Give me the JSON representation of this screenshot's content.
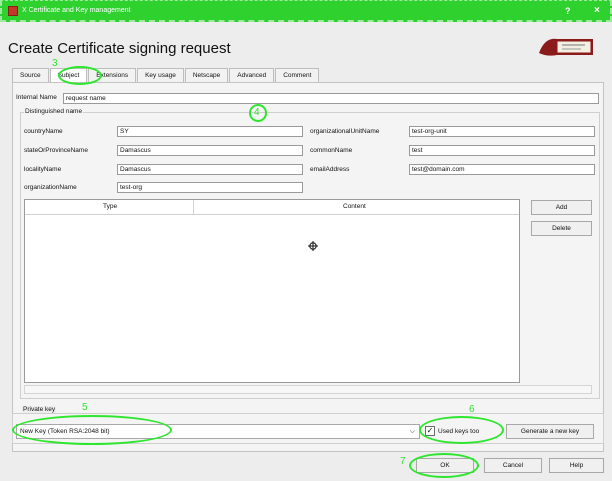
{
  "window": {
    "title": "X Certificate and Key management",
    "help": "?",
    "close": "×"
  },
  "dialog": {
    "heading": "Create Certificate signing request"
  },
  "tabs": [
    "Source",
    "Subject",
    "Extensions",
    "Key usage",
    "Netscape",
    "Advanced",
    "Comment"
  ],
  "subject": {
    "internal_name_label": "Internal Name",
    "internal_name_value": "request name",
    "group_label": "Distinguished name",
    "fields": {
      "countryName": {
        "label": "countryName",
        "value": "SY"
      },
      "stateOrProvinceName": {
        "label": "stateOrProvinceName",
        "value": "Damascus"
      },
      "localityName": {
        "label": "localityName",
        "value": "Damascus"
      },
      "organizationName": {
        "label": "organizationName",
        "value": "test-org"
      },
      "organizationalUnitName": {
        "label": "organizationalUnitName",
        "value": "test-org-unit"
      },
      "commonName": {
        "label": "commonName",
        "value": "test"
      },
      "emailAddress": {
        "label": "emailAddress",
        "value": "test@domain.com"
      }
    },
    "table": {
      "columns": [
        "Type",
        "Content"
      ]
    },
    "add_label": "Add",
    "delete_label": "Delete"
  },
  "private_key": {
    "group_label": "Private key",
    "selected": "New Key (Token RSA:2048 bit)",
    "used_keys_label": "Used keys too",
    "used_keys_checked": true,
    "generate_label": "Generate a new key"
  },
  "footer": {
    "ok": "OK",
    "cancel": "Cancel",
    "help": "Help"
  },
  "annotations": {
    "n3": "3",
    "n4": "4",
    "n5": "5",
    "n6": "6",
    "n7": "7"
  },
  "colors": {
    "titlebar": "#2ed12e",
    "annotation": "#2ee62e"
  }
}
